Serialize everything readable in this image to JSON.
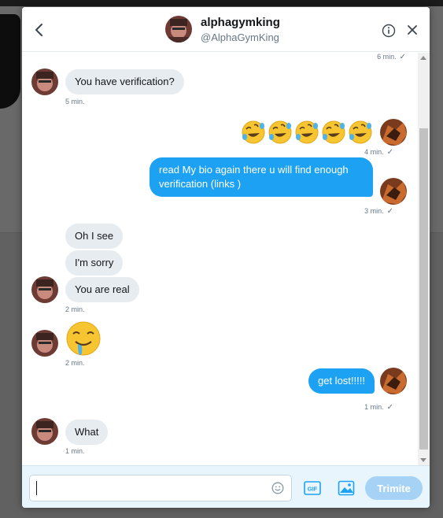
{
  "header": {
    "name": "alphagymking",
    "handle": "@AlphaGymKing"
  },
  "messages": [
    {
      "from": "them",
      "text": "You have verification?",
      "time": "5 min."
    },
    {
      "from": "me",
      "emoji": "rolling-on-floor-laughing x5",
      "time": "4 min."
    },
    {
      "from": "me",
      "text": "read My bio again there u will find enough verification (links )",
      "time": "3 min."
    },
    {
      "from": "them",
      "text": "Oh I see"
    },
    {
      "from": "them",
      "text": "I'm sorry"
    },
    {
      "from": "them",
      "text": "You are real",
      "time": "2 min."
    },
    {
      "from": "them",
      "emoji": "drooling-face",
      "time": "2 min."
    },
    {
      "from": "me",
      "text": "get lost!!!!!",
      "time": "1 min."
    },
    {
      "from": "them",
      "text": "What",
      "time": "1 min."
    }
  ],
  "top_time": "6 min.",
  "composer": {
    "placeholder": "",
    "send_label": "Trimite",
    "gif_label": "GIF"
  },
  "colors": {
    "sent_bubble": "#1da1f2",
    "received_bubble": "#e6ecf0",
    "send_button_disabled": "#a6d3f5"
  },
  "icons": [
    "back-arrow-icon",
    "info-icon",
    "close-icon",
    "emoji-icon",
    "gif-icon",
    "image-icon",
    "checkmark-icon"
  ]
}
